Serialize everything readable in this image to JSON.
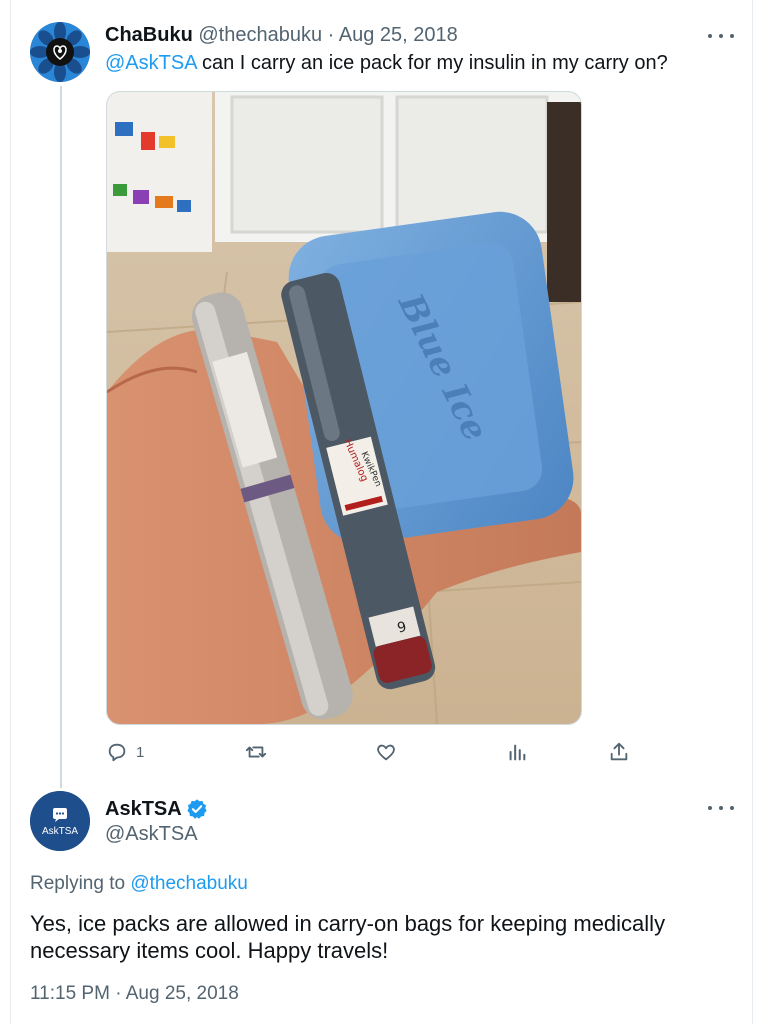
{
  "original_tweet": {
    "name": "ChaBuku",
    "handle": "@thechabuku",
    "separator": "·",
    "date": "Aug 25, 2018",
    "mention": "@AskTSA",
    "text": " can I carry an ice pack for my insulin in my carry on?",
    "image_label": "Blue Ice",
    "pen_label_1": "Humalog",
    "pen_label_2": "KwikPen",
    "pen_dial": "9",
    "actions": {
      "reply_icon": "reply-icon",
      "reply_count": "1",
      "retweet_icon": "retweet-icon",
      "like_icon": "like-icon",
      "views_icon": "views-icon",
      "share_icon": "share-icon"
    }
  },
  "reply_tweet": {
    "avatar_text": "AskTSA",
    "name": "AskTSA",
    "verified_icon": "verified-badge-icon",
    "handle": "@AskTSA",
    "replying_prefix": "Replying to",
    "replying_to": "@thechabuku",
    "text": "Yes, ice packs are allowed in carry-on bags for keeping medically necessary items cool. Happy travels!",
    "timestamp": "11:15 PM · Aug 25, 2018"
  },
  "colors": {
    "link": "#1d9bf0",
    "secondary_text": "#536471",
    "primary_text": "#0f1419",
    "verified": "#1d9bf0",
    "asktsa_avatar": "#1f4e8c"
  }
}
